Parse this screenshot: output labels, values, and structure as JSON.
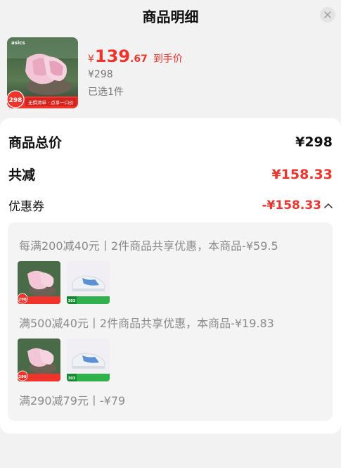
{
  "header": {
    "title": "商品明细"
  },
  "product": {
    "yen_symbol": "¥",
    "price_integer": "139",
    "price_decimal": ".67",
    "price_tag": "到手价",
    "original_price": "¥298",
    "selected_count": "已选1件",
    "image_badge_price": "298",
    "image_banner": "无惧清单 · 点享一口价",
    "brand_logo_text": "asics"
  },
  "summary": {
    "total_label": "商品总价",
    "total_value": "¥298",
    "discount_label": "共减",
    "discount_value": "¥158.33",
    "coupon_label": "优惠券",
    "coupon_value": "-¥158.33"
  },
  "coupons": [
    {
      "text": "每满200减40元丨2件商品共享优惠，本商品-¥59.5"
    },
    {
      "text": "满500减40元丨2件商品共享优惠，本商品-¥19.83"
    },
    {
      "text": "满290减79元丨-¥79"
    }
  ],
  "mini_products": {
    "pink_badge": "298",
    "white_badge": "303"
  },
  "colors": {
    "accent_red": "#f0332b",
    "background": "#f2f2f2",
    "panel": "#ffffff",
    "coupon_box": "#f4f4f4"
  }
}
